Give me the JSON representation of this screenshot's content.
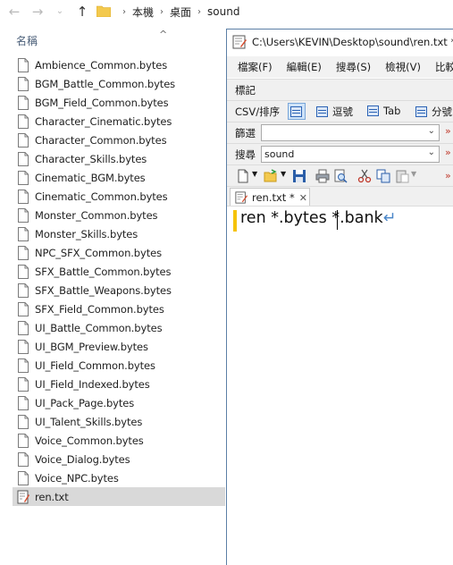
{
  "explorer": {
    "breadcrumb": [
      "本機",
      "桌面",
      "sound"
    ],
    "column_name": "名稱",
    "files": [
      "Ambience_Common.bytes",
      "BGM_Battle_Common.bytes",
      "BGM_Field_Common.bytes",
      "Character_Cinematic.bytes",
      "Character_Common.bytes",
      "Character_Skills.bytes",
      "Cinematic_BGM.bytes",
      "Cinematic_Common.bytes",
      "Monster_Common.bytes",
      "Monster_Skills.bytes",
      "NPC_SFX_Common.bytes",
      "SFX_Battle_Common.bytes",
      "SFX_Battle_Weapons.bytes",
      "SFX_Field_Common.bytes",
      "UI_Battle_Common.bytes",
      "UI_BGM_Preview.bytes",
      "UI_Field_Common.bytes",
      "UI_Field_Indexed.bytes",
      "UI_Pack_Page.bytes",
      "UI_Talent_Skills.bytes",
      "Voice_Common.bytes",
      "Voice_Dialog.bytes",
      "Voice_NPC.bytes",
      "ren.txt"
    ],
    "selected_file": "ren.txt"
  },
  "editor": {
    "title": "C:\\Users\\KEVIN\\Desktop\\sound\\ren.txt *",
    "menu": [
      "檔案(F)",
      "編輯(E)",
      "搜尋(S)",
      "檢視(V)",
      "比較"
    ],
    "bookmark_bar_label": "標記",
    "csv_bar": {
      "label": "CSV/排序",
      "comma_button": "逗號",
      "tab_button": "Tab",
      "semicolon_button": "分號"
    },
    "filter_label": "篩選",
    "filter_value": "",
    "search_label": "搜尋",
    "search_value": "sound",
    "tab_label": "ren.txt *",
    "text_line": "ren *.bytes *.bank",
    "eol_glyph": "↵"
  }
}
